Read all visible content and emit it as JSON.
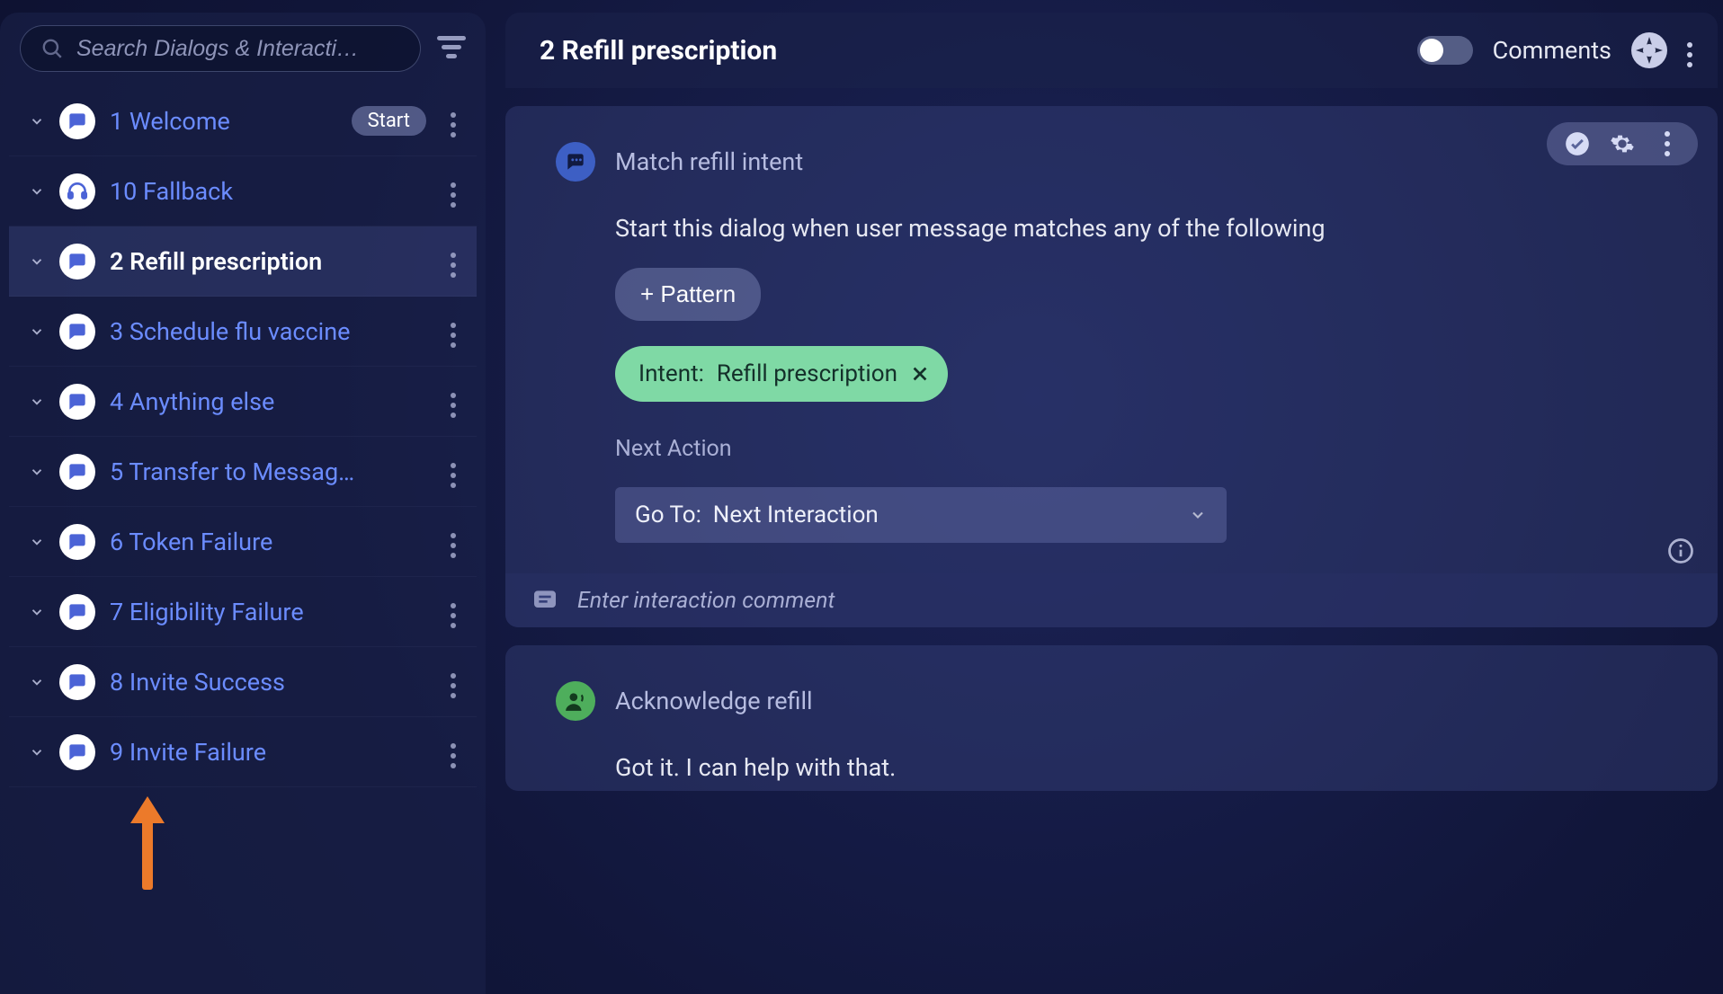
{
  "sidebar": {
    "search_placeholder": "Search Dialogs & Interacti…",
    "items": [
      {
        "label": "1 Welcome",
        "badge": "Start",
        "icon": "chat",
        "active": false
      },
      {
        "label": "10 Fallback",
        "badge": null,
        "icon": "headset",
        "active": false
      },
      {
        "label": "2 Refill prescription",
        "badge": null,
        "icon": "chat",
        "active": true
      },
      {
        "label": "3 Schedule flu vaccine",
        "badge": null,
        "icon": "chat",
        "active": false
      },
      {
        "label": "4 Anything else",
        "badge": null,
        "icon": "chat",
        "active": false
      },
      {
        "label": "5 Transfer to Messag…",
        "badge": null,
        "icon": "chat",
        "active": false
      },
      {
        "label": "6 Token Failure",
        "badge": null,
        "icon": "chat",
        "active": false
      },
      {
        "label": "7 Eligibility Failure",
        "badge": null,
        "icon": "chat",
        "active": false
      },
      {
        "label": "8 Invite Success",
        "badge": null,
        "icon": "chat",
        "active": false
      },
      {
        "label": "9 Invite Failure",
        "badge": null,
        "icon": "chat",
        "active": false
      }
    ]
  },
  "header": {
    "title": "2 Refill prescription",
    "comments_label": "Comments"
  },
  "intent_card": {
    "title": "Match refill intent",
    "description": "Start this dialog when user message matches any of the following",
    "pattern_button": "+ Pattern",
    "chip_prefix": "Intent:",
    "chip_value": "Refill prescription",
    "next_action_label": "Next Action",
    "select_prefix": "Go To:",
    "select_value": "Next Interaction",
    "comment_placeholder": "Enter interaction comment"
  },
  "ack_card": {
    "title": "Acknowledge refill",
    "text": "Got it. I can help with that."
  }
}
